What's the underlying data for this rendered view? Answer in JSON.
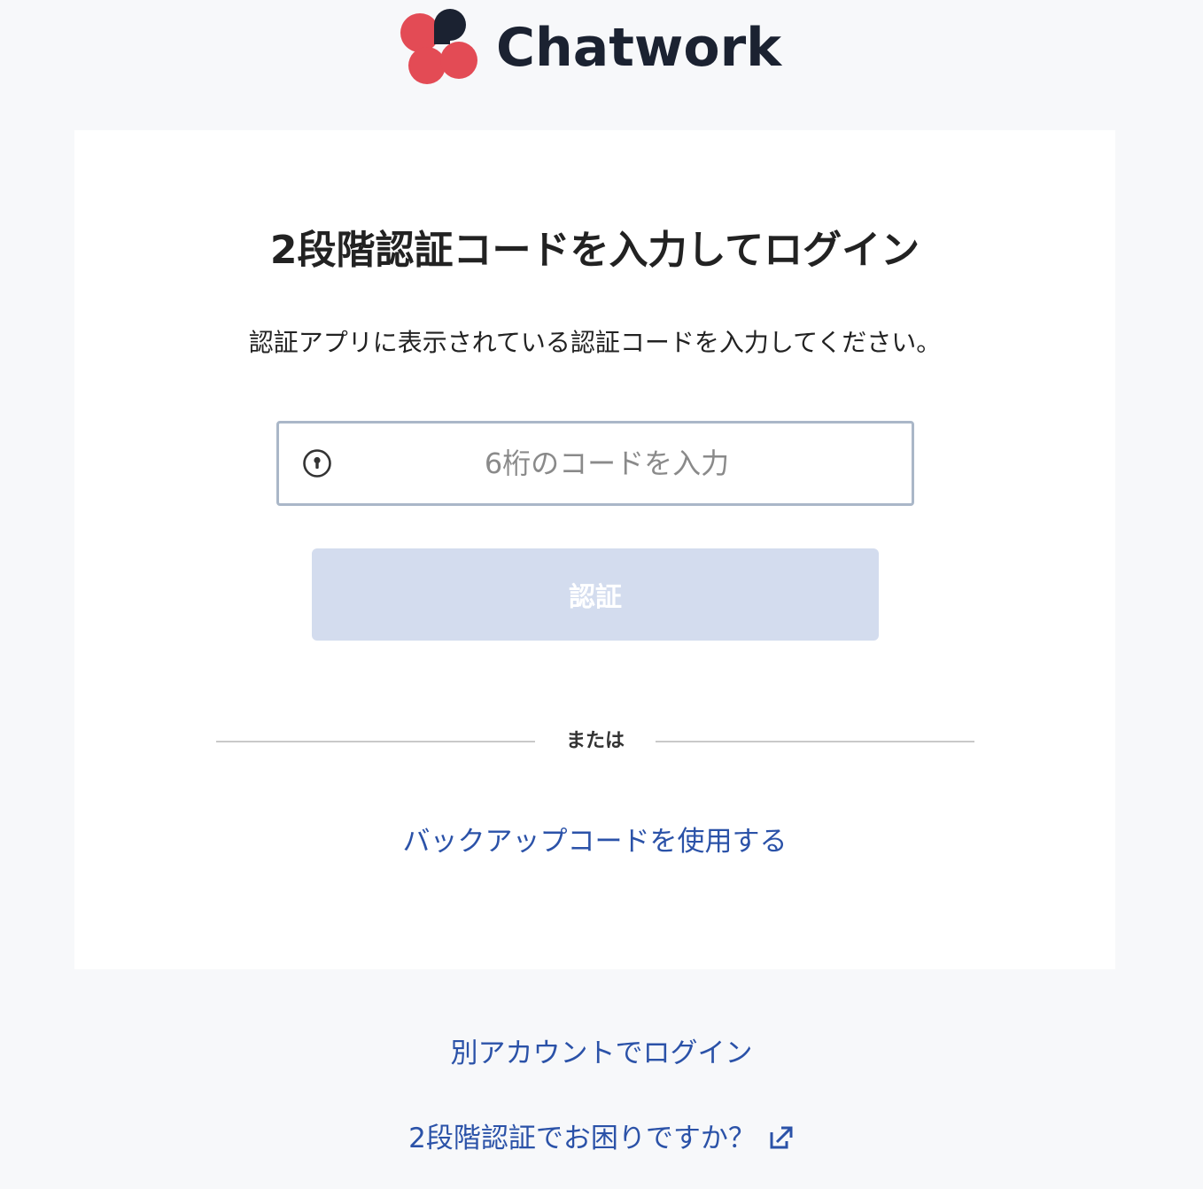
{
  "brand": {
    "name": "Chatwork",
    "colors": {
      "petal_red": "#e34b55",
      "petal_dark": "#1b2231",
      "text": "#1b2231"
    }
  },
  "card": {
    "title": "2段階認証コードを入力してログイン",
    "description": "認証アプリに表示されている認証コードを入力してください。",
    "code_input": {
      "icon": "key-icon",
      "placeholder": "6桁のコードを入力",
      "value": ""
    },
    "verify_button": {
      "label": "認証",
      "state": "disabled"
    },
    "divider_label": "または",
    "backup_link": "バックアップコードを使用する"
  },
  "footer": {
    "other_account_link": "別アカウントでログイン",
    "help_link": "2段階認証でお困りですか？",
    "help_icon": "external-link-icon"
  },
  "colors": {
    "page_background": "#f7f8fa",
    "card_background": "#ffffff",
    "link": "#2b52a8",
    "input_border": "#aab7c8",
    "button_disabled_bg": "#d3dcee",
    "button_text": "#ffffff"
  }
}
